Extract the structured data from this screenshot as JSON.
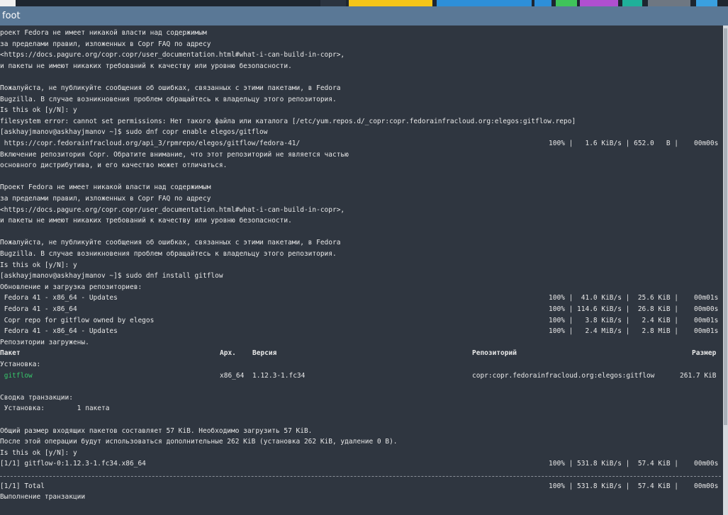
{
  "window": {
    "title": "foot"
  },
  "taskbar_colors": [
    "#f0f0f0",
    "#2b3440",
    "#f5c518",
    "#2d8fd9",
    "#2d8fd9",
    "#3fc45a",
    "#b04fd0",
    "#1fb09a",
    "#6e7782",
    "#3aa0e0"
  ],
  "terminal": {
    "lines": [
      "роект Fedora не имеет никакой власти над содержимым",
      "за пределами правил, изложенных в Copr FAQ по адресу",
      "<https://docs.pagure.org/copr.copr/user_documentation.html#what-i-can-build-in-copr>,",
      "и пакеты не имеют никаких требований к качеству или уровню безопасности.",
      "",
      "Пожалуйста, не публикуйте сообщения об ошибках, связанных с этими пакетами, в Fedora",
      "Bugzilla. В случае возникновения проблем обращайтесь к владельцу этого репозитория.",
      "Is this ok [y/N]: y",
      "filesystem error: cannot set permissions: Нет такого файла или каталога [/etc/yum.repos.d/_copr:copr.fedorainfracloud.org:elegos:gitflow.repo]",
      "[askhayjmanov@askhayjmanov ~]$ sudo dnf copr enable elegos/gitflow",
      " https://copr.fedorainfracloud.org/api_3/rpmrepo/elegos/gitflow/fedora-41/",
      "Включение репозитория Copr. Обратите внимание, что этот репозиторий не является частью",
      "основного дистрибутива, и его качество может отличаться.",
      "",
      "Проект Fedora не имеет никакой власти над содержимым",
      "за пределами правил, изложенных в Copr FAQ по адресу",
      "<https://docs.pagure.org/copr.copr/user_documentation.html#what-i-can-build-in-copr>,",
      "и пакеты не имеют никаких требований к качеству или уровню безопасности.",
      "",
      "Пожалуйста, не публикуйте сообщения об ошибках, связанных с этими пакетами, в Fedora",
      "Bugzilla. В случае возникновения проблем обращайтесь к владельцу этого репозитория.",
      "Is this ok [y/N]: y",
      "[askhayjmanov@askhayjmanov ~]$ sudo dnf install gitflow",
      "Обновление и загрузка репозиториев:",
      " Fedora 41 - x86_64 - Updates",
      " Fedora 41 - x86_64",
      " Copr repo for gitflow owned by elegos",
      " Fedora 41 - x86_64 - Updates",
      "Репозитории загружены.",
      "",
      "Установка:",
      "",
      "",
      "Сводка транзакции:",
      " Установка:        1 пакета",
      "",
      "Общий размер входящих пакетов составляет 57 KiB. Необходимо загрузить 57 KiB.",
      "После этой операции будут использоваться дополнительные 262 KiB (установка 262 KiB, удаление 0 B).",
      "Is this ok [y/N]: y",
      "[1/1] gitflow-0:1.12.3-1.fc34.x86_64",
      "",
      "[1/1] Total",
      "Выполнение транзакции"
    ],
    "progress": [
      {
        "row": 10,
        "text": "100% |   1.6 KiB/s | 652.0   B |",
        "tail": "00m00s"
      },
      {
        "row": 24,
        "text": "100% |  41.0 KiB/s |  25.6 KiB |",
        "tail": "00m01s"
      },
      {
        "row": 25,
        "text": "100% | 114.6 KiB/s |  26.8 KiB |",
        "tail": "00m00s"
      },
      {
        "row": 26,
        "text": "100% |   3.8 KiB/s |   2.4 KiB |",
        "tail": "00m01s"
      },
      {
        "row": 27,
        "text": "100% |   2.4 MiB/s |   2.8 MiB |",
        "tail": "00m01s"
      },
      {
        "row": 39,
        "text": "100% | 531.8 KiB/s |  57.4 KiB |",
        "tail": "00m00s"
      },
      {
        "row": 41,
        "text": "100% | 531.8 KiB/s |  57.4 KiB |",
        "tail": "00m00s"
      }
    ],
    "table": {
      "headers": {
        "package": "Пакет",
        "arch": "Арх.",
        "version": "Версия",
        "repo": "Репозиторий",
        "size": "Размер"
      },
      "row": {
        "package": " gitflow",
        "arch": "x86_64",
        "version": "1.12.3-1.fc34",
        "repo": "copr:copr.fedorainfracloud.org:elegos:gitflow",
        "size": "261.7 KiB"
      }
    }
  }
}
